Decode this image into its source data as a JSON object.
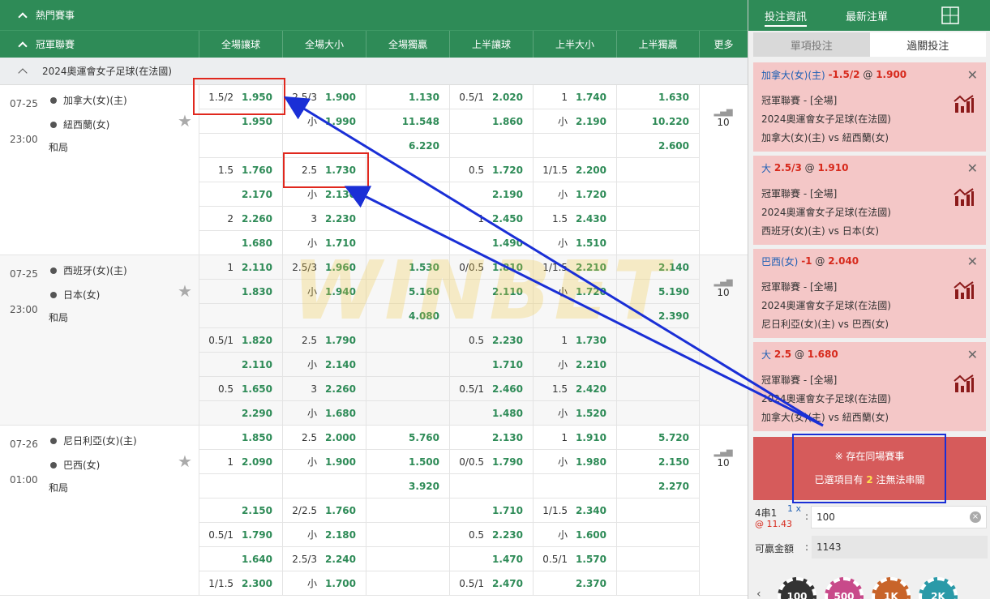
{
  "topbar": {
    "hot_label": "熱門賽事"
  },
  "header": {
    "league_col": "冠軍聯賽",
    "cols": [
      "全場讓球",
      "全場大小",
      "全場獨贏",
      "上半讓球",
      "上半大小",
      "上半獨贏",
      "更多"
    ]
  },
  "league": {
    "name": "2024奧運會女子足球(在法國)"
  },
  "matches": [
    {
      "date": "07-25",
      "time": "23:00",
      "home": "加拿大(女)(主)",
      "away": "紐西蘭(女)",
      "draw": "和局",
      "more": "10",
      "rows": [
        [
          [
            "1.5/2",
            "1.950"
          ],
          [
            "2.5/3",
            "1.900"
          ],
          [
            "",
            "1.130"
          ],
          [
            "0.5/1",
            "2.020"
          ],
          [
            "1",
            "1.740"
          ],
          [
            "",
            "1.630"
          ]
        ],
        [
          [
            "",
            "1.950"
          ],
          [
            "小",
            "1.990"
          ],
          [
            "",
            "11.548"
          ],
          [
            "",
            "1.860"
          ],
          [
            "小",
            "2.190"
          ],
          [
            "",
            "10.220"
          ]
        ],
        [
          [
            "",
            ""
          ],
          [
            "",
            ""
          ],
          [
            "",
            "6.220"
          ],
          [
            "",
            ""
          ],
          [
            "",
            ""
          ],
          [
            "",
            "2.600"
          ]
        ],
        [
          [
            "1.5",
            "1.760"
          ],
          [
            "2.5",
            "1.730"
          ],
          [
            "",
            ""
          ],
          [
            "0.5",
            "1.720"
          ],
          [
            "1/1.5",
            "2.200"
          ],
          [
            "",
            ""
          ]
        ],
        [
          [
            "",
            "2.170"
          ],
          [
            "小",
            "2.130"
          ],
          [
            "",
            ""
          ],
          [
            "",
            "2.190"
          ],
          [
            "小",
            "1.720"
          ],
          [
            "",
            ""
          ]
        ],
        [
          [
            "2",
            "2.260"
          ],
          [
            "3",
            "2.230"
          ],
          [
            "",
            ""
          ],
          [
            "1",
            "2.450"
          ],
          [
            "1.5",
            "2.430"
          ],
          [
            "",
            ""
          ]
        ],
        [
          [
            "",
            "1.680"
          ],
          [
            "小",
            "1.710"
          ],
          [
            "",
            ""
          ],
          [
            "",
            "1.490"
          ],
          [
            "小",
            "1.510"
          ],
          [
            "",
            ""
          ]
        ]
      ]
    },
    {
      "date": "07-25",
      "time": "23:00",
      "home": "西班牙(女)(主)",
      "away": "日本(女)",
      "draw": "和局",
      "more": "10",
      "rows": [
        [
          [
            "1",
            "2.110"
          ],
          [
            "2.5/3",
            "1.960"
          ],
          [
            "",
            "1.530"
          ],
          [
            "0/0.5",
            "1.810"
          ],
          [
            "1/1.5",
            "2.210"
          ],
          [
            "",
            "2.140"
          ]
        ],
        [
          [
            "",
            "1.830"
          ],
          [
            "小",
            "1.940"
          ],
          [
            "",
            "5.160"
          ],
          [
            "",
            "2.110"
          ],
          [
            "小",
            "1.720"
          ],
          [
            "",
            "5.190"
          ]
        ],
        [
          [
            "",
            ""
          ],
          [
            "",
            ""
          ],
          [
            "",
            "4.080"
          ],
          [
            "",
            ""
          ],
          [
            "",
            ""
          ],
          [
            "",
            "2.390"
          ]
        ],
        [
          [
            "0.5/1",
            "1.820"
          ],
          [
            "2.5",
            "1.790"
          ],
          [
            "",
            ""
          ],
          [
            "0.5",
            "2.230"
          ],
          [
            "1",
            "1.730"
          ],
          [
            "",
            ""
          ]
        ],
        [
          [
            "",
            "2.110"
          ],
          [
            "小",
            "2.140"
          ],
          [
            "",
            ""
          ],
          [
            "",
            "1.710"
          ],
          [
            "小",
            "2.210"
          ],
          [
            "",
            ""
          ]
        ],
        [
          [
            "0.5",
            "1.650"
          ],
          [
            "3",
            "2.260"
          ],
          [
            "",
            ""
          ],
          [
            "0.5/1",
            "2.460"
          ],
          [
            "1.5",
            "2.420"
          ],
          [
            "",
            ""
          ]
        ],
        [
          [
            "",
            "2.290"
          ],
          [
            "小",
            "1.680"
          ],
          [
            "",
            ""
          ],
          [
            "",
            "1.480"
          ],
          [
            "小",
            "1.520"
          ],
          [
            "",
            ""
          ]
        ]
      ]
    },
    {
      "date": "07-26",
      "time": "01:00",
      "home": "尼日利亞(女)(主)",
      "away": "巴西(女)",
      "draw": "和局",
      "more": "10",
      "rows": [
        [
          [
            "",
            "1.850"
          ],
          [
            "2.5",
            "2.000"
          ],
          [
            "",
            "5.760"
          ],
          [
            "",
            "2.130"
          ],
          [
            "1",
            "1.910"
          ],
          [
            "",
            "5.720"
          ]
        ],
        [
          [
            "1",
            "2.090"
          ],
          [
            "小",
            "1.900"
          ],
          [
            "",
            "1.500"
          ],
          [
            "0/0.5",
            "1.790"
          ],
          [
            "小",
            "1.980"
          ],
          [
            "",
            "2.150"
          ]
        ],
        [
          [
            "",
            ""
          ],
          [
            "",
            ""
          ],
          [
            "",
            "3.920"
          ],
          [
            "",
            ""
          ],
          [
            "",
            ""
          ],
          [
            "",
            "2.270"
          ]
        ],
        [
          [
            "",
            "2.150"
          ],
          [
            "2/2.5",
            "1.760"
          ],
          [
            "",
            ""
          ],
          [
            "",
            "1.710"
          ],
          [
            "1/1.5",
            "2.340"
          ],
          [
            "",
            ""
          ]
        ],
        [
          [
            "0.5/1",
            "1.790"
          ],
          [
            "小",
            "2.180"
          ],
          [
            "",
            ""
          ],
          [
            "0.5",
            "2.230"
          ],
          [
            "小",
            "1.600"
          ],
          [
            "",
            ""
          ]
        ],
        [
          [
            "",
            "1.640"
          ],
          [
            "2.5/3",
            "2.240"
          ],
          [
            "",
            ""
          ],
          [
            "",
            "1.470"
          ],
          [
            "0.5/1",
            "1.570"
          ],
          [
            "",
            ""
          ]
        ],
        [
          [
            "1/1.5",
            "2.300"
          ],
          [
            "小",
            "1.700"
          ],
          [
            "",
            ""
          ],
          [
            "0.5/1",
            "2.470"
          ],
          [
            "",
            "2.370"
          ],
          [
            "",
            ""
          ]
        ]
      ]
    }
  ],
  "watermark": "WINBET",
  "right": {
    "tabs": [
      "投注資訊",
      "最新注單"
    ],
    "subtabs": [
      "單項投注",
      "過關投注"
    ],
    "slips": [
      {
        "team": "加拿大(女)(主)",
        "line": "-1.5/2",
        "at": "@",
        "odds": "1.900",
        "l1": "冠軍聯賽 - [全場]",
        "l2": "2024奧運會女子足球(在法國)",
        "l3": "加拿大(女)(主) vs 紐西蘭(女)"
      },
      {
        "team": "大",
        "line": "2.5/3",
        "at": "@",
        "odds": "1.910",
        "l1": "冠軍聯賽 - [全場]",
        "l2": "2024奧運會女子足球(在法國)",
        "l3": "西班牙(女)(主) vs 日本(女)"
      },
      {
        "team": "巴西(女)",
        "line": "-1",
        "at": "@",
        "odds": "2.040",
        "l1": "冠軍聯賽 - [全場]",
        "l2": "2024奧運會女子足球(在法國)",
        "l3": "尼日利亞(女)(主) vs 巴西(女)"
      },
      {
        "team": "大",
        "line": "2.5",
        "at": "@",
        "odds": "1.680",
        "l1": "冠軍聯賽 - [全場]",
        "l2": "2024奧運會女子足球(在法國)",
        "l3": "加拿大(女)(主) vs 紐西蘭(女)"
      }
    ],
    "warn_line1": "※ 存在同場賽事",
    "warn_line2_a": "已選項目有",
    "warn_count": "2",
    "warn_line2_b": "注無法串關",
    "parlay_label": "4串1",
    "parlay_mult": "1 x",
    "parlay_odds": "@ 11.43",
    "stake_value": "100",
    "win_label": "可贏金額",
    "win_value": "1143",
    "chips": [
      "100",
      "500",
      "1K",
      "2K"
    ]
  },
  "colors": {
    "green": "#2e8b57",
    "odds_green": "#2e8b57",
    "highlight": "#f8d4d4",
    "slip_bg": "#f4c7c7",
    "warn_bg": "#d65b5b",
    "arrow": "#1a2fd6",
    "box_red": "#e0281e"
  }
}
